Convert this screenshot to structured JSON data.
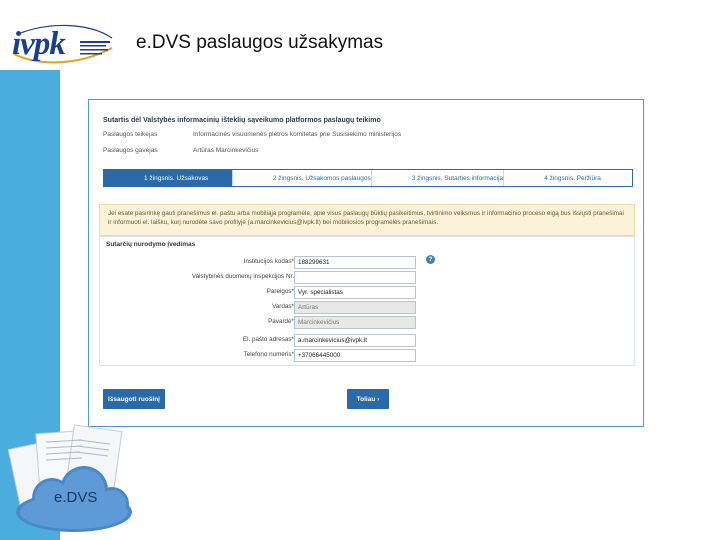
{
  "header": {
    "logo_text": "ivpk",
    "title": "e.DVS paslaugos užsakymas"
  },
  "contract": {
    "title": "Sutartis dėl Valstybės informacinių išteklių sąveikumo platformos paslaugų teikimo",
    "rows": [
      {
        "label": "Paslaugos teikėjas",
        "value": "Informacinės visuomenės plėtros komitetas prie Susisiekimo ministerijos"
      },
      {
        "label": "Paslaugos gavėjas",
        "value": "Artūras Marcinkevičius"
      }
    ]
  },
  "steps": [
    "1 žingsnis. Užsakovas",
    "2 žingsnis. Užsakomos paslaugos",
    "3 žingsnis. Sutarties informacija",
    "4 žingsnis. Peržiūra"
  ],
  "notice": "Jei esate pasirinkę gauti pranešimus el. paštu arba mobiliąja programėle, apie visus paslaugų būklių pasikeitimus, tvirtinimo veiksmus ir informacinio proceso eigą bus išsiųsti pranešimai ir informuoti el. laišku, kurį nurodėte savo profilyje (a.marcinkevicius@ivpk.lt) bei mobiliosios programėlės pranešimais.",
  "form": {
    "heading": "Sutarčių nurodymo įvedimas",
    "fields": [
      {
        "label": "Institucijos kodas*",
        "value": "188299631",
        "disabled": false
      },
      {
        "label": "Valstybinės duomenų inspekcijos Nr.",
        "value": "",
        "disabled": false
      },
      {
        "label": "Pareigos*",
        "value": "Vyr. specialistas",
        "disabled": false
      },
      {
        "label": "Vardas*",
        "value": "Artūras",
        "disabled": true
      },
      {
        "label": "Pavardė*",
        "value": "Marcinkevičius",
        "disabled": true
      },
      {
        "label": "El. pašto adresas*",
        "value": "a.marcinkevicius@ivpk.lt",
        "disabled": false
      },
      {
        "label": "Telefono numeris*",
        "value": "+37066445000",
        "disabled": false
      }
    ],
    "help_icon": "?"
  },
  "buttons": {
    "save": "Išsaugoti ruošinį",
    "next": "Toliau ›"
  },
  "illustration_label": "e.DVS",
  "colors": {
    "accent": "#2a6aa8",
    "side_strip": "#4baddd",
    "notice_bg": "#fbf2d9"
  }
}
